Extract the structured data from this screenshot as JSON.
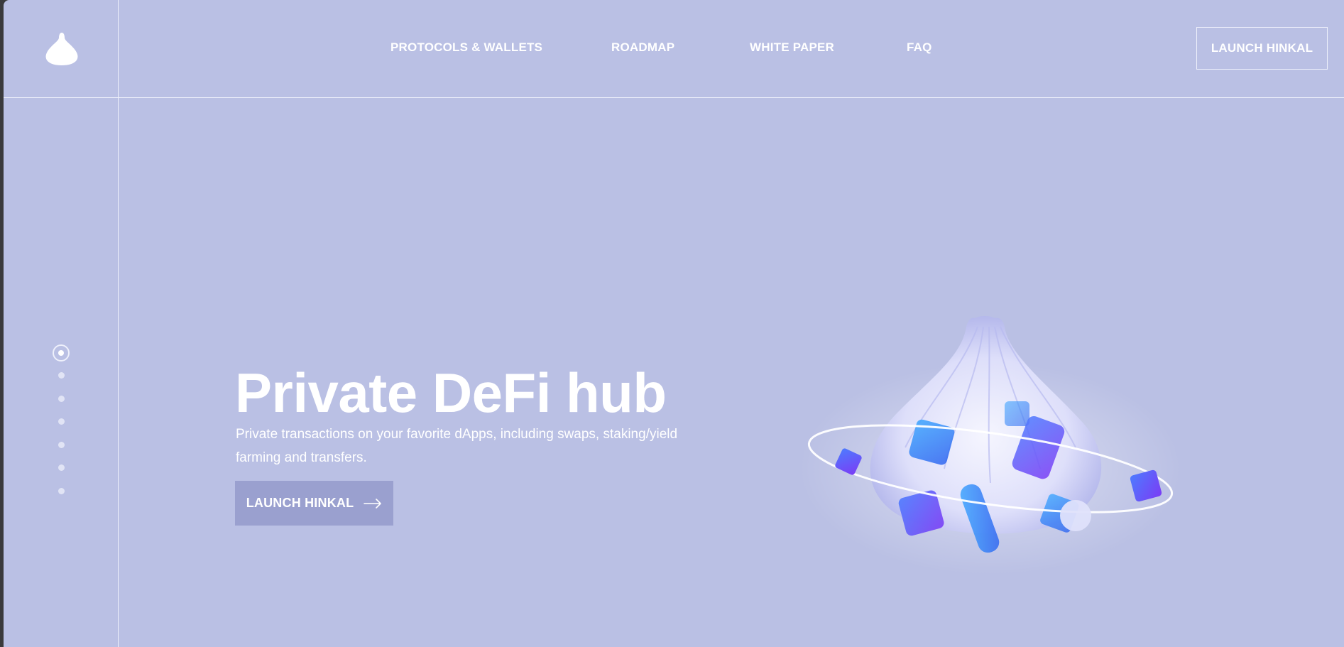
{
  "header": {
    "logo_icon": "dumpling-logo-icon",
    "nav": [
      {
        "label": "PROTOCOLS & WALLETS"
      },
      {
        "label": "ROADMAP"
      },
      {
        "label": "WHITE PAPER"
      },
      {
        "label": "FAQ"
      }
    ],
    "launch_label": "LAUNCH HINKAL"
  },
  "sidebar": {
    "slides_count": 7,
    "active_slide": 1
  },
  "hero": {
    "title": "Private DeFi hub",
    "subtitle": "Private transactions on your favorite dApps, including swaps, staking/yield farming and transfers.",
    "cta_label": "LAUNCH HINKAL",
    "cta_icon": "arrow-right-icon",
    "illustration": "dumpling-with-cubes-illustration"
  },
  "colors": {
    "background": "#bac0e4",
    "button": "#9aa0cf",
    "text": "#ffffff"
  }
}
